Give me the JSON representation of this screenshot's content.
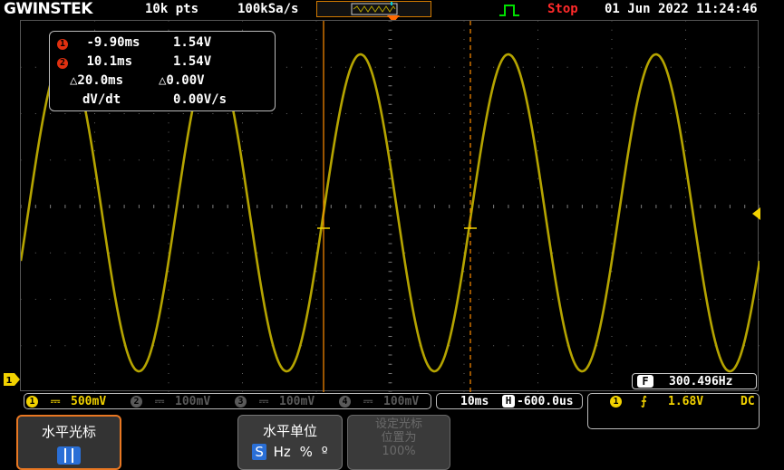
{
  "topbar": {
    "logo": "GWINSTEK",
    "record_length": "10k pts",
    "sample_rate": "100kSa/s",
    "run_state": "Stop",
    "datetime": "01 Jun 2022 11:24:46"
  },
  "measurements": {
    "cursor1": {
      "badge": "1",
      "time": "-9.90ms",
      "voltage": "1.54V"
    },
    "cursor2": {
      "badge": "2",
      "time": "10.1ms",
      "voltage": "1.54V"
    },
    "delta": {
      "time": "△20.0ms",
      "voltage": "△0.00V"
    },
    "slope": {
      "label": "dV/dt",
      "value": "0.00V/s"
    }
  },
  "frequency": {
    "badge": "F",
    "value": "300.496Hz"
  },
  "channels": [
    {
      "num": "1",
      "coupling": "⎓",
      "scale": "500mV",
      "color": "#f2d200",
      "active": true
    },
    {
      "num": "2",
      "coupling": "⎓",
      "scale": "100mV",
      "color": "#5a5a5a",
      "active": false
    },
    {
      "num": "3",
      "coupling": "⎓",
      "scale": "100mV",
      "color": "#5a5a5a",
      "active": false
    },
    {
      "num": "4",
      "coupling": "⎓",
      "scale": "100mV",
      "color": "#5a5a5a",
      "active": false
    }
  ],
  "timebase": {
    "scale": "10ms",
    "badge": "H",
    "position": "-600.0us"
  },
  "trigger": {
    "source": "1",
    "slope": "⨍",
    "level": "1.68V",
    "coupling": "DC"
  },
  "ch1_marker": "1",
  "cursor_labels": {
    "c1": "1",
    "c2": "2"
  },
  "softkeys": {
    "horizontal_cursor": {
      "title": "水平光标"
    },
    "horizontal_unit": {
      "title": "水平单位",
      "options": [
        "S",
        "Hz",
        "%",
        "º"
      ]
    },
    "set_cursor": {
      "line1": "设定光标",
      "line2": "位置为",
      "line3": "100%"
    }
  },
  "colors": {
    "trace": "#b5a400",
    "cursor": "#ff8c00",
    "accent": "#e87722"
  }
}
